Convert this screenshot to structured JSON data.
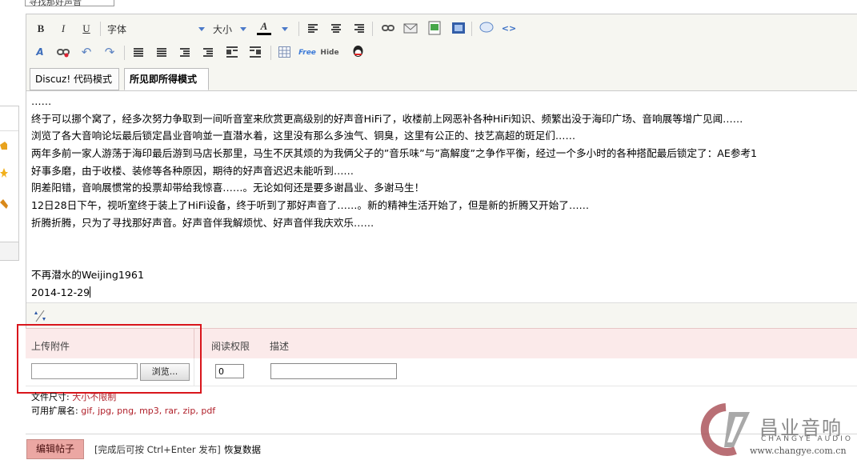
{
  "top": {
    "field_text": "寻找那好声音"
  },
  "toolbar": {
    "bold": "B",
    "italic": "I",
    "underline": "U",
    "font_label": "字体",
    "size_label": "大小",
    "color_label": "A",
    "free_label": "Free",
    "hide_label": "Hide"
  },
  "tabs": {
    "code_mode": "Discuz! 代码模式",
    "wysiwyg_mode": "所见即所得模式"
  },
  "content": {
    "lines": [
      "……",
      "终于可以挪个窝了，经多次努力争取到一间听音室来欣赏更高级别的好声音HiFi了，收楼前上网恶补各种HiFi知识、频繁出没于海印广场、音响展等增广见闻……",
      "浏览了各大音响论坛最后锁定昌业音响並一直潜水着，这里没有那么多浊气、铜臭，这里有公正的、技艺高超的斑足们……",
      "两年多前一家人游荡于海印最后游到马店长那里，马生不厌其烦的为我俩父子的”音乐味”与”高解度”之争作平衡，经过一个多小时的各种搭配最后锁定了：AE参考1",
      "好事多磨，由于收楼、装修等各种原因，期待的好声音迟迟未能听到……",
      "阴差阳错，音响展惯常的投票却带给我惊喜……。无论如何还是要多谢昌业、多谢马生！",
      "12日28日下午，视听室终于装上了HiFi设备，终于听到了那好声音了……。新的精神生活开始了，但是新的折腾又开始了……",
      "折腾折腾，只为了寻找那好声音。好声音伴我解烦忧、好声音伴我庆欢乐……",
      "",
      "",
      "不再潜水的Weijing1961",
      "2014-12-29"
    ]
  },
  "attachments": {
    "upload_label": "上传附件",
    "permission_label": "阅读权限",
    "description_label": "描述",
    "browse_button": "浏览...",
    "permission_value": "0",
    "size_label": "文件尺寸:",
    "size_value": "大小不限制",
    "ext_label": "可用扩展名:",
    "ext_value": "gif, jpg, png, mp3, rar, zip, pdf"
  },
  "bottom": {
    "edit_button": "编辑帖子",
    "hint": "[完成后可按 Ctrl+Enter 发布]",
    "restore": "恢复数据"
  },
  "watermark": {
    "brand_cn": "昌业音响",
    "brand_en": "CHANGYE AUDIO",
    "url": "www.changye.com.cn"
  },
  "colors": {
    "attachment_header_bg": "#fbeaea",
    "highlight_box": "#d9161c",
    "edit_button_bg": "#eba7a3",
    "toolbar_bg": "#f6f6f1"
  }
}
